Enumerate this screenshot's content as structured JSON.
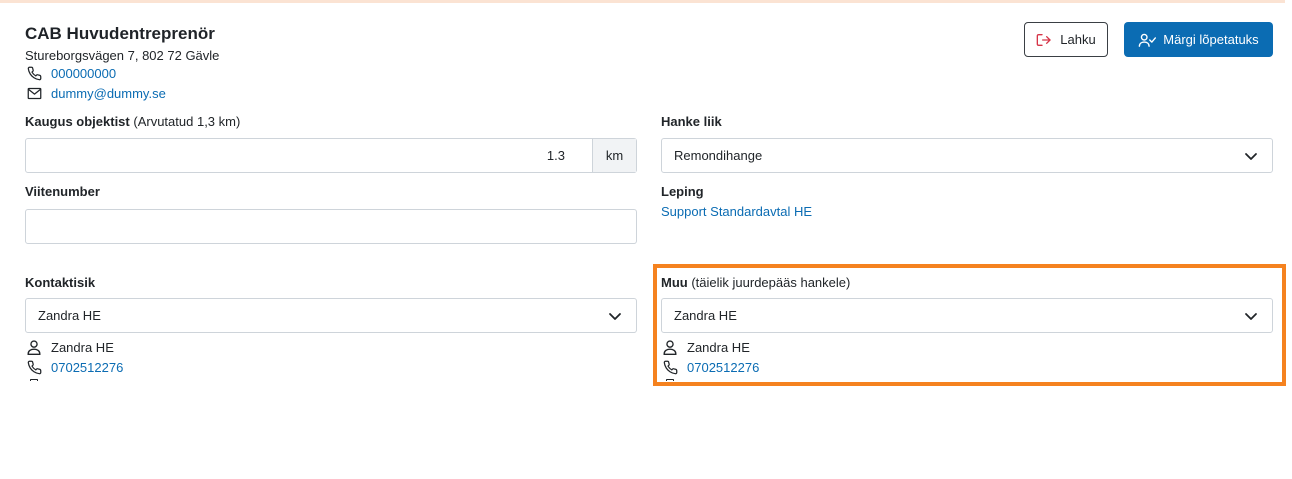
{
  "company": {
    "name": "CAB Huvudentreprenör",
    "address": "Stureborgsvägen 7, 802 72 Gävle",
    "phone": "000000000",
    "email": "dummy@dummy.se"
  },
  "actions": {
    "leave_label": "Lahku",
    "complete_label": "Märgi lõpetatuks"
  },
  "fields": {
    "distance": {
      "label": "Kaugus objektist",
      "hint": "(Arvutatud 1,3 km)",
      "value": "1.3",
      "unit": "km"
    },
    "project_type": {
      "label": "Hanke liik",
      "value": "Remondihange"
    },
    "reference": {
      "label": "Viitenumber",
      "value": ""
    },
    "contract": {
      "label": "Leping",
      "value": "Support Standardavtal HE"
    },
    "contact": {
      "label": "Kontaktisik",
      "selected": "Zandra HE",
      "person_name": "Zandra HE",
      "person_phone": "0702512276"
    },
    "other": {
      "label": "Muu",
      "hint": "(täielik juurdepääs hankele)",
      "selected": "Zandra HE",
      "person_name": "Zandra HE",
      "person_phone": "0702512276"
    }
  },
  "colors": {
    "primary": "#0b6cb3",
    "highlight": "#f5821f",
    "leave_icon": "#d63447"
  },
  "icons": {
    "phone": "phone-icon",
    "mail": "mail-icon",
    "leave": "sign-out-icon",
    "complete": "user-check-icon",
    "chevron": "chevron-down-icon",
    "person": "user-icon"
  }
}
